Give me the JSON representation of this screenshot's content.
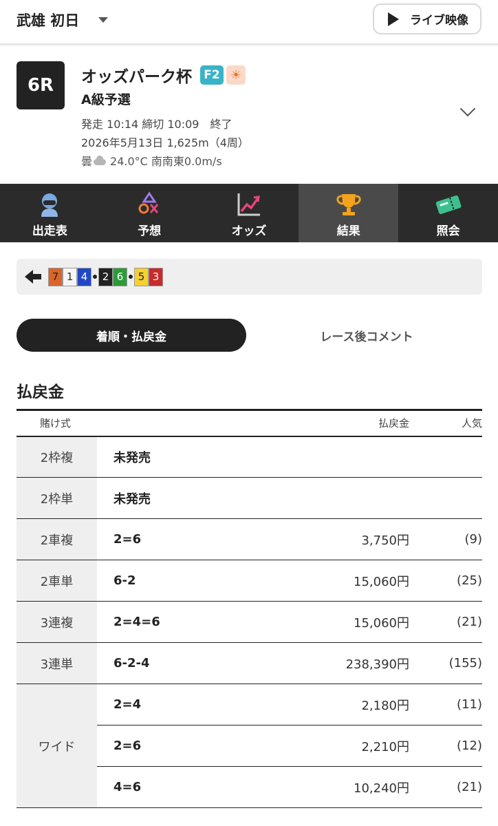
{
  "header": {
    "venue_day": "武雄 初日",
    "live_label": "ライブ映像"
  },
  "race": {
    "number": "6R",
    "title": "オッズパーク杯",
    "grade_badge": "F2",
    "weather_badge": "☀",
    "class": "A級予選",
    "info_line1": "発走 10:14 締切 10:09　終了",
    "info_line2": "2026年5月13日 1,625m（4周）",
    "weather_text": "曇",
    "conditions": "24.0°C 南南東0.0m/s"
  },
  "tabs": [
    {
      "label": "出走表",
      "icon": "rider-icon",
      "active": false
    },
    {
      "label": "予想",
      "icon": "prediction-icon",
      "active": false
    },
    {
      "label": "オッズ",
      "icon": "odds-chart-icon",
      "active": false
    },
    {
      "label": "結果",
      "icon": "trophy-icon",
      "active": true
    },
    {
      "label": "照会",
      "icon": "ticket-icon",
      "active": false
    }
  ],
  "finish_order": {
    "chips": [
      {
        "num": "7",
        "bg": "#d9652a",
        "fg": "#222222"
      },
      {
        "num": "1",
        "bg": "#f5f5f5",
        "fg": "#333333"
      },
      {
        "num": "4",
        "bg": "#1f47c8",
        "fg": "#ffffff"
      },
      {
        "num": "2",
        "bg": "#222222",
        "fg": "#ffffff"
      },
      {
        "num": "6",
        "bg": "#2e9a3a",
        "fg": "#ffffff"
      },
      {
        "num": "5",
        "bg": "#f6d02c",
        "fg": "#222222"
      },
      {
        "num": "3",
        "bg": "#c92a2a",
        "fg": "#ffffff"
      }
    ]
  },
  "segments": {
    "active": "着順・払戻金",
    "inactive": "レース後コメント"
  },
  "payout": {
    "title": "払戻金",
    "headers": {
      "type": "賭け式",
      "payout": "払戻金",
      "popularity": "人気"
    },
    "rows": [
      {
        "type": "2枠複",
        "combo": "未発売",
        "payout": "",
        "popularity": ""
      },
      {
        "type": "2枠単",
        "combo": "未発売",
        "payout": "",
        "popularity": ""
      },
      {
        "type": "2車複",
        "combo": "2=6",
        "payout": "3,750円",
        "popularity": "(9)"
      },
      {
        "type": "2車単",
        "combo": "6-2",
        "payout": "15,060円",
        "popularity": "(25)"
      },
      {
        "type": "3連複",
        "combo": "2=4=6",
        "payout": "15,060円",
        "popularity": "(21)"
      },
      {
        "type": "3連単",
        "combo": "6-2-4",
        "payout": "238,390円",
        "popularity": "(155)"
      }
    ],
    "wide": {
      "type": "ワイド",
      "rows": [
        {
          "combo": "2=4",
          "payout": "2,180円",
          "popularity": "(11)"
        },
        {
          "combo": "2=6",
          "payout": "2,210円",
          "popularity": "(12)"
        },
        {
          "combo": "4=6",
          "payout": "10,240円",
          "popularity": "(21)"
        }
      ]
    }
  }
}
